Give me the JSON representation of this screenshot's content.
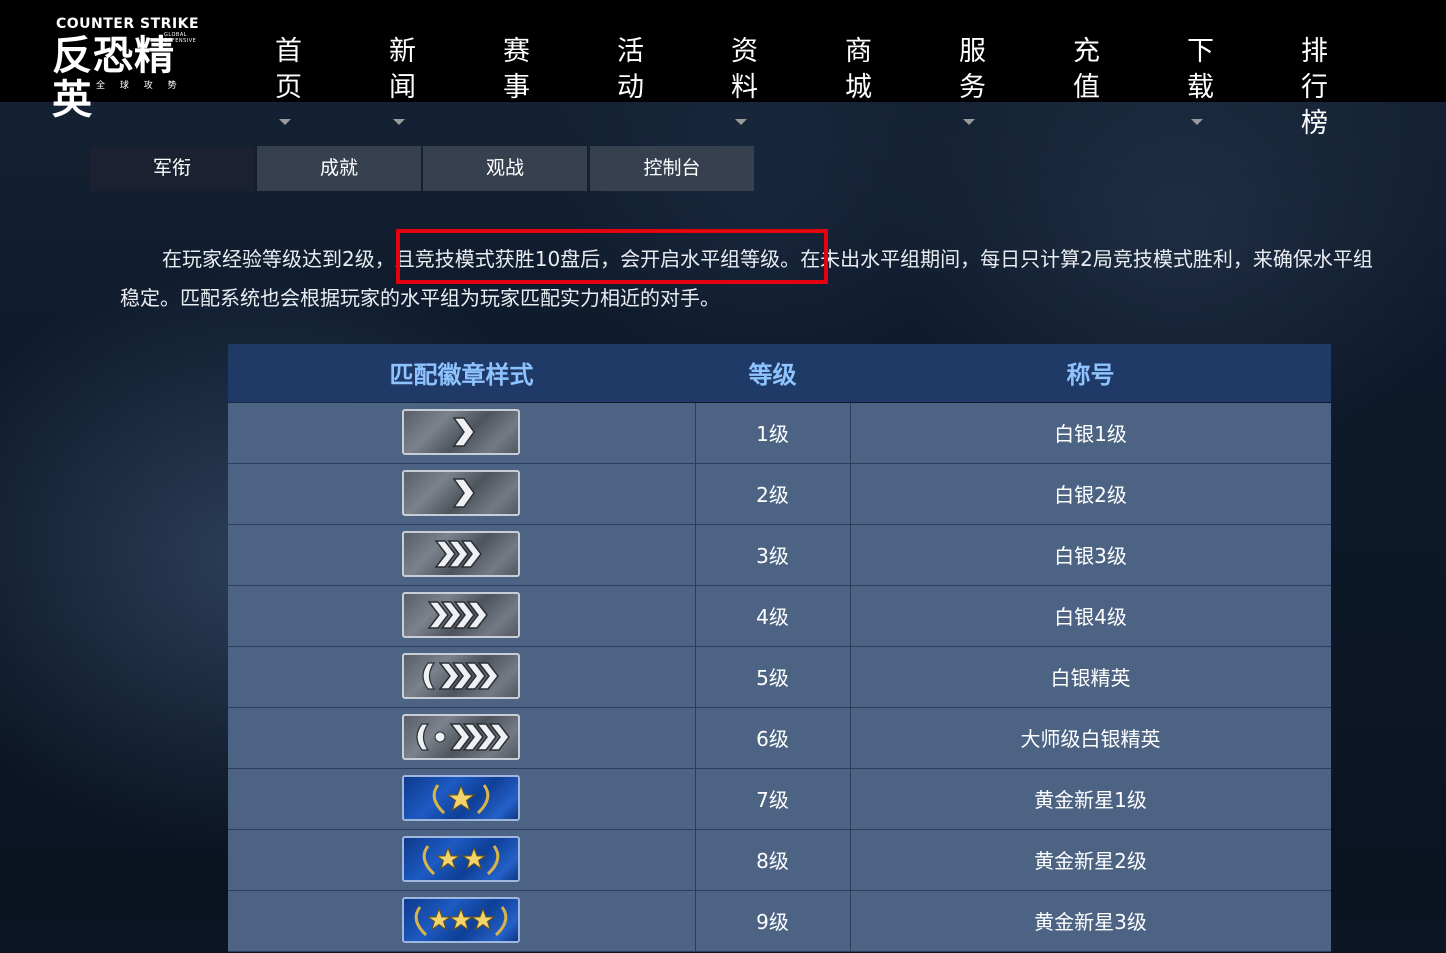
{
  "header": {
    "logo": {
      "brand_en": "COUNTER STRIKE",
      "brand_cn": "反恐精英",
      "sub_en": "GLOBAL OFFENSIVE",
      "sub_cn": "全 球 攻 势"
    },
    "nav": [
      {
        "label": "首页",
        "dropdown": true
      },
      {
        "label": "新闻",
        "dropdown": true
      },
      {
        "label": "赛事",
        "dropdown": false
      },
      {
        "label": "活动",
        "dropdown": false
      },
      {
        "label": "资料",
        "dropdown": true
      },
      {
        "label": "商城",
        "dropdown": false
      },
      {
        "label": "服务",
        "dropdown": true
      },
      {
        "label": "充值",
        "dropdown": false
      },
      {
        "label": "下载",
        "dropdown": true
      },
      {
        "label": "排行榜",
        "dropdown": false
      }
    ]
  },
  "tabs": [
    {
      "label": "军衔",
      "active": true
    },
    {
      "label": "成就",
      "active": false
    },
    {
      "label": "观战",
      "active": false
    },
    {
      "label": "控制台",
      "active": false
    }
  ],
  "intro": {
    "before": "在玩家经验等级达到2级，",
    "highlight": "且竞技模式获胜10盘后，会开启水平组等级。",
    "after_line1": "在未出水平组期间，每日只计算2局竞技模式胜利，来确保水平组",
    "line2": "稳定。匹配系统也会根据玩家的水平组为玩家匹配实力相近的对手。"
  },
  "rank_table": {
    "headers": [
      "匹配徽章样式",
      "等级",
      "称号"
    ],
    "rows": [
      {
        "badge": "silver-1-chevron-icon",
        "level": "1级",
        "title": "白银1级"
      },
      {
        "badge": "silver-1-chevron-icon",
        "level": "2级",
        "title": "白银2级"
      },
      {
        "badge": "silver-3-chevrons-icon",
        "level": "3级",
        "title": "白银3级"
      },
      {
        "badge": "silver-4-chevrons-icon",
        "level": "4级",
        "title": "白银4级"
      },
      {
        "badge": "silver-elite-icon",
        "level": "5级",
        "title": "白银精英"
      },
      {
        "badge": "silver-elite-master-icon",
        "level": "6级",
        "title": "大师级白银精英"
      },
      {
        "badge": "gold-nova-1-star-icon",
        "level": "7级",
        "title": "黄金新星1级"
      },
      {
        "badge": "gold-nova-2-stars-icon",
        "level": "8级",
        "title": "黄金新星2级"
      },
      {
        "badge": "gold-nova-3-stars-icon",
        "level": "9级",
        "title": "黄金新星3级"
      }
    ]
  },
  "colors": {
    "header_bg": "#000000",
    "tab_active_bg": "#1b2130",
    "tab_bg": "#37404f",
    "table_header_bg": "#1f3a66",
    "table_header_text": "#8fc3ff",
    "table_row_bg": "#4c6383",
    "highlight_border": "#e3000f"
  }
}
